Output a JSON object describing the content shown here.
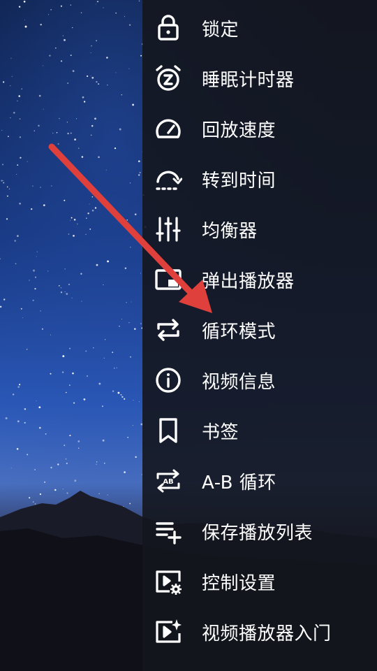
{
  "menu": {
    "items": [
      {
        "label": "锁定",
        "icon": "lock-icon"
      },
      {
        "label": "睡眠计时器",
        "icon": "alarm-timer-icon"
      },
      {
        "label": "回放速度",
        "icon": "speed-gauge-icon"
      },
      {
        "label": "转到时间",
        "icon": "jump-to-time-icon"
      },
      {
        "label": "均衡器",
        "icon": "equalizer-icon"
      },
      {
        "label": "弹出播放器",
        "icon": "popup-player-icon"
      },
      {
        "label": "循环模式",
        "icon": "repeat-icon"
      },
      {
        "label": "视频信息",
        "icon": "info-icon"
      },
      {
        "label": "书签",
        "icon": "bookmark-icon"
      },
      {
        "label": "A-B 循环",
        "icon": "ab-repeat-icon"
      },
      {
        "label": "保存播放列表",
        "icon": "playlist-add-icon"
      },
      {
        "label": "控制设置",
        "icon": "video-settings-icon"
      },
      {
        "label": "视频播放器入门",
        "icon": "video-sparkle-icon"
      }
    ]
  },
  "colors": {
    "panel_bg": "#14161e",
    "text": "#ffffff",
    "annotation_arrow": "#e0403c"
  }
}
